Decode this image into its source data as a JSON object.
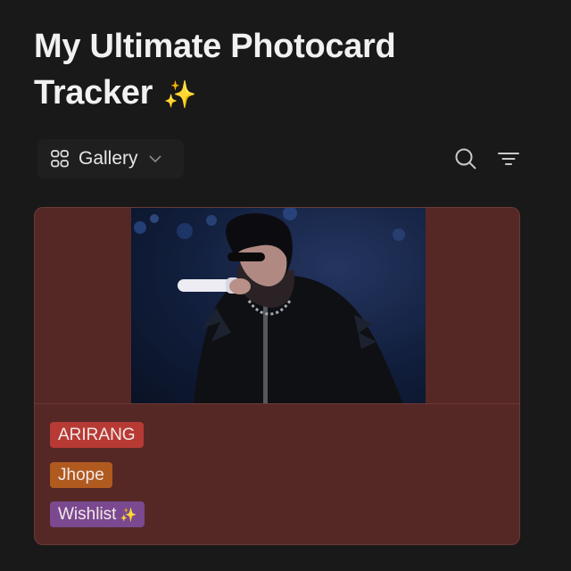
{
  "page": {
    "title_text": "My Ultimate Photocard Tracker",
    "title_emoji": "✨"
  },
  "view": {
    "label": "Gallery",
    "icon": "gallery-grid-icon",
    "dropdown_icon": "chevron-down-icon"
  },
  "toolbar": {
    "search_icon": "search-icon",
    "filter_icon": "filter-icon"
  },
  "card": {
    "image_icon": "concert-performer-photo",
    "tags": [
      {
        "label": "ARIRANG",
        "emoji": "",
        "color": "#b83a35"
      },
      {
        "label": "Jhope",
        "emoji": "",
        "color": "#b15a20"
      },
      {
        "label": "Wishlist",
        "emoji": "✨",
        "color": "#7a4990"
      }
    ]
  },
  "colors": {
    "background": "#191919",
    "card_background": "#552825",
    "sparkle": "#f5c342"
  }
}
